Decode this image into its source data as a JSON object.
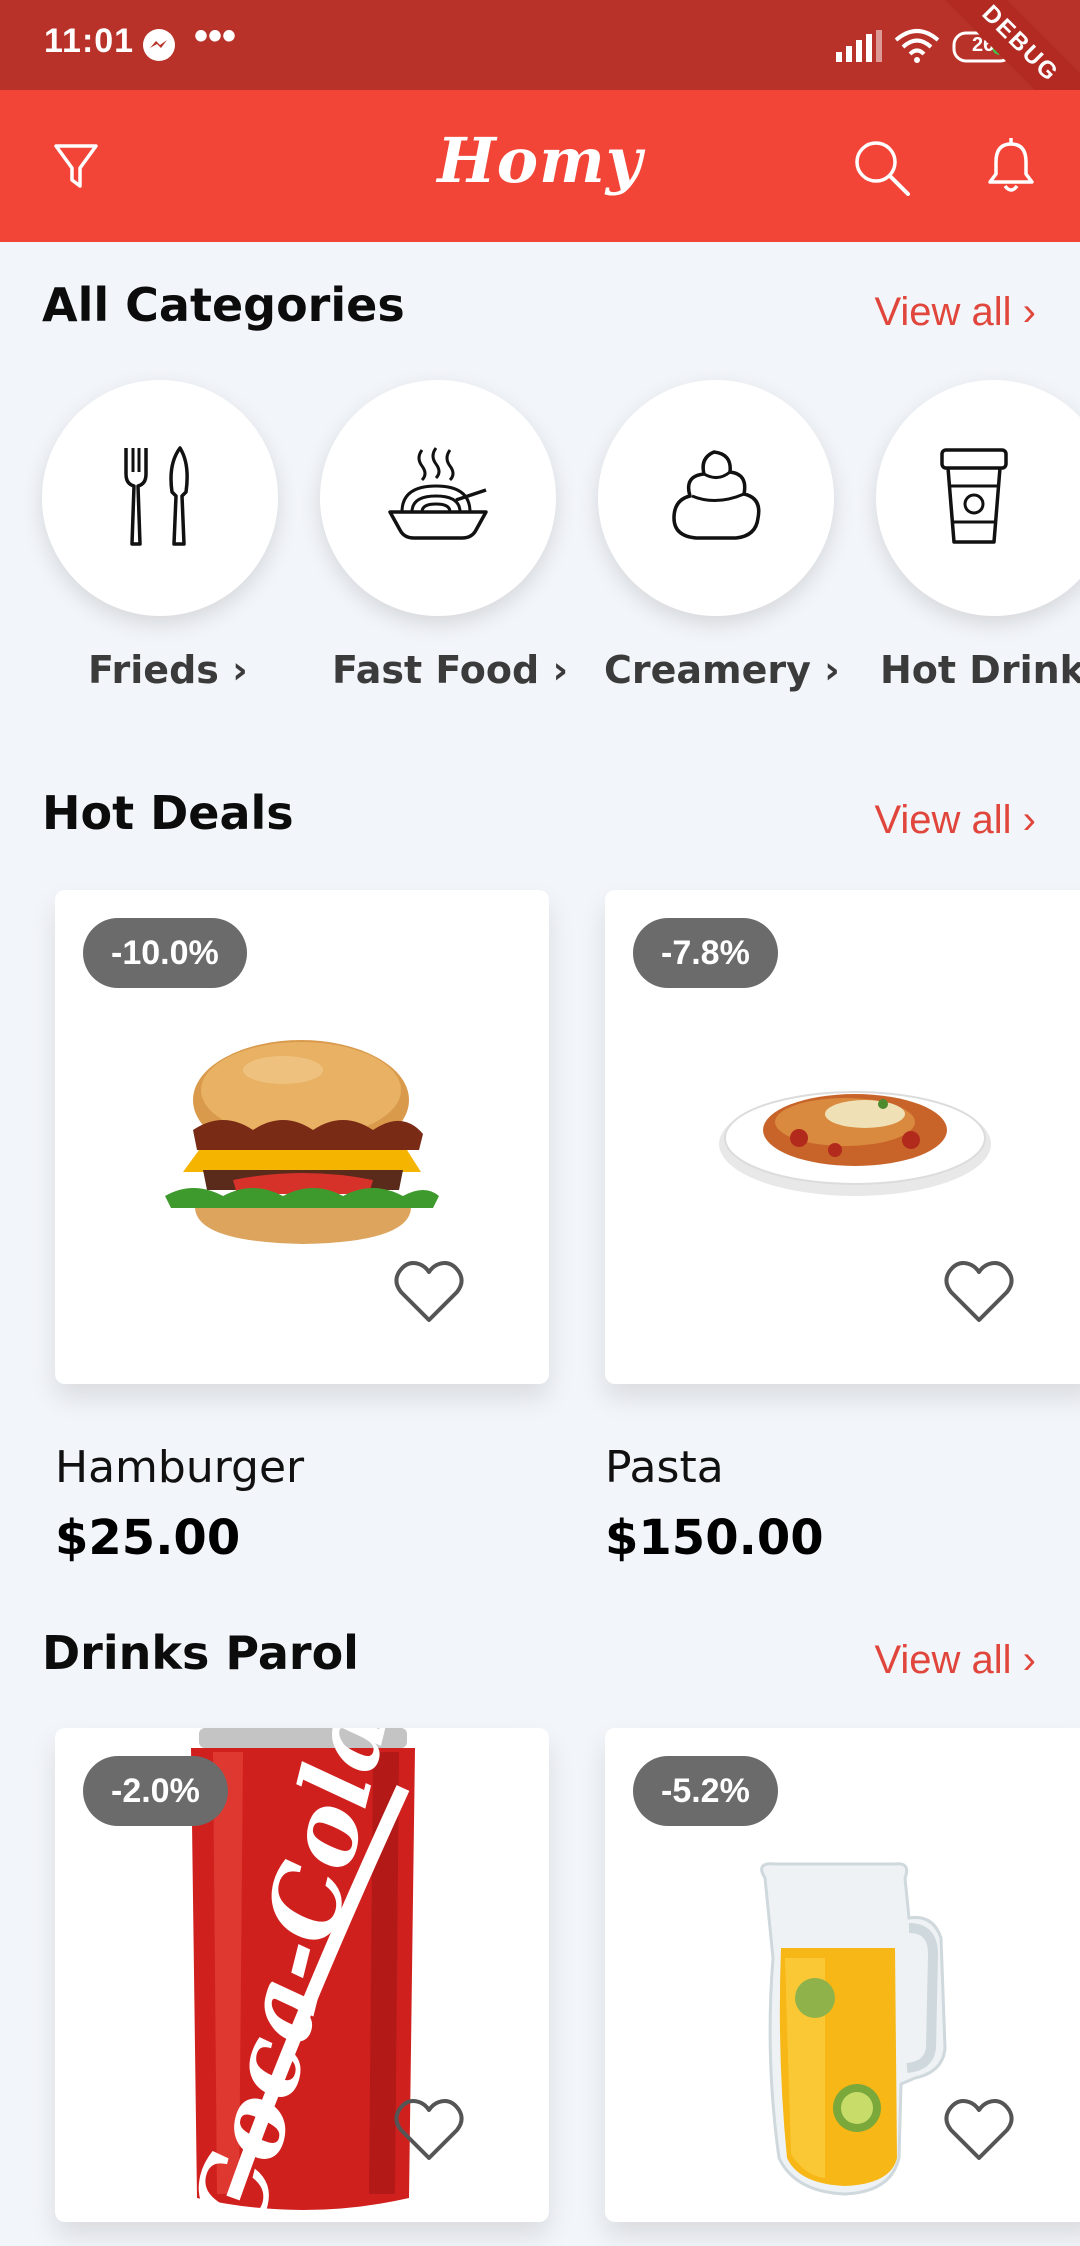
{
  "status_bar": {
    "time": "11:01",
    "overflow": "•••",
    "battery": "26",
    "debug_banner": "DEBUG",
    "icons": [
      "messenger-icon",
      "signal-icon",
      "wifi-icon",
      "battery-icon"
    ]
  },
  "app_bar": {
    "title": "Homy",
    "background_color": "#f24437",
    "icons": [
      "filter-icon",
      "search-icon",
      "bell-icon"
    ]
  },
  "categories": {
    "title": "All Categories",
    "view_all": "View all ›",
    "items": [
      {
        "label": "Frieds ›",
        "icon": "cutlery-icon"
      },
      {
        "label": "Fast Food ›",
        "icon": "noodle-bowl-icon"
      },
      {
        "label": "Creamery ›",
        "icon": "ice-cream-icon"
      },
      {
        "label": "Hot Drinks",
        "icon": "coffee-cup-icon"
      }
    ]
  },
  "hot_deals": {
    "title": "Hot Deals",
    "view_all": "View all ›",
    "items": [
      {
        "name": "Hamburger",
        "price": "$25.00",
        "discount": "-10.0%",
        "image": "hamburger-image"
      },
      {
        "name": "Pasta",
        "price": "$150.00",
        "discount": "-7.8%",
        "image": "pasta-image"
      }
    ]
  },
  "drinks": {
    "title": "Drinks Parol",
    "view_all": "View all ›",
    "items": [
      {
        "discount": "-2.0%",
        "image": "cola-can-image",
        "brand_text": "Coca-Cola"
      },
      {
        "discount": "-5.2%",
        "image": "juice-pitcher-image"
      }
    ]
  },
  "colors": {
    "accent": "#e0463b",
    "status_bar": "#b8322a",
    "badge": "#6b6b6b",
    "background": "#f2f5f9"
  }
}
